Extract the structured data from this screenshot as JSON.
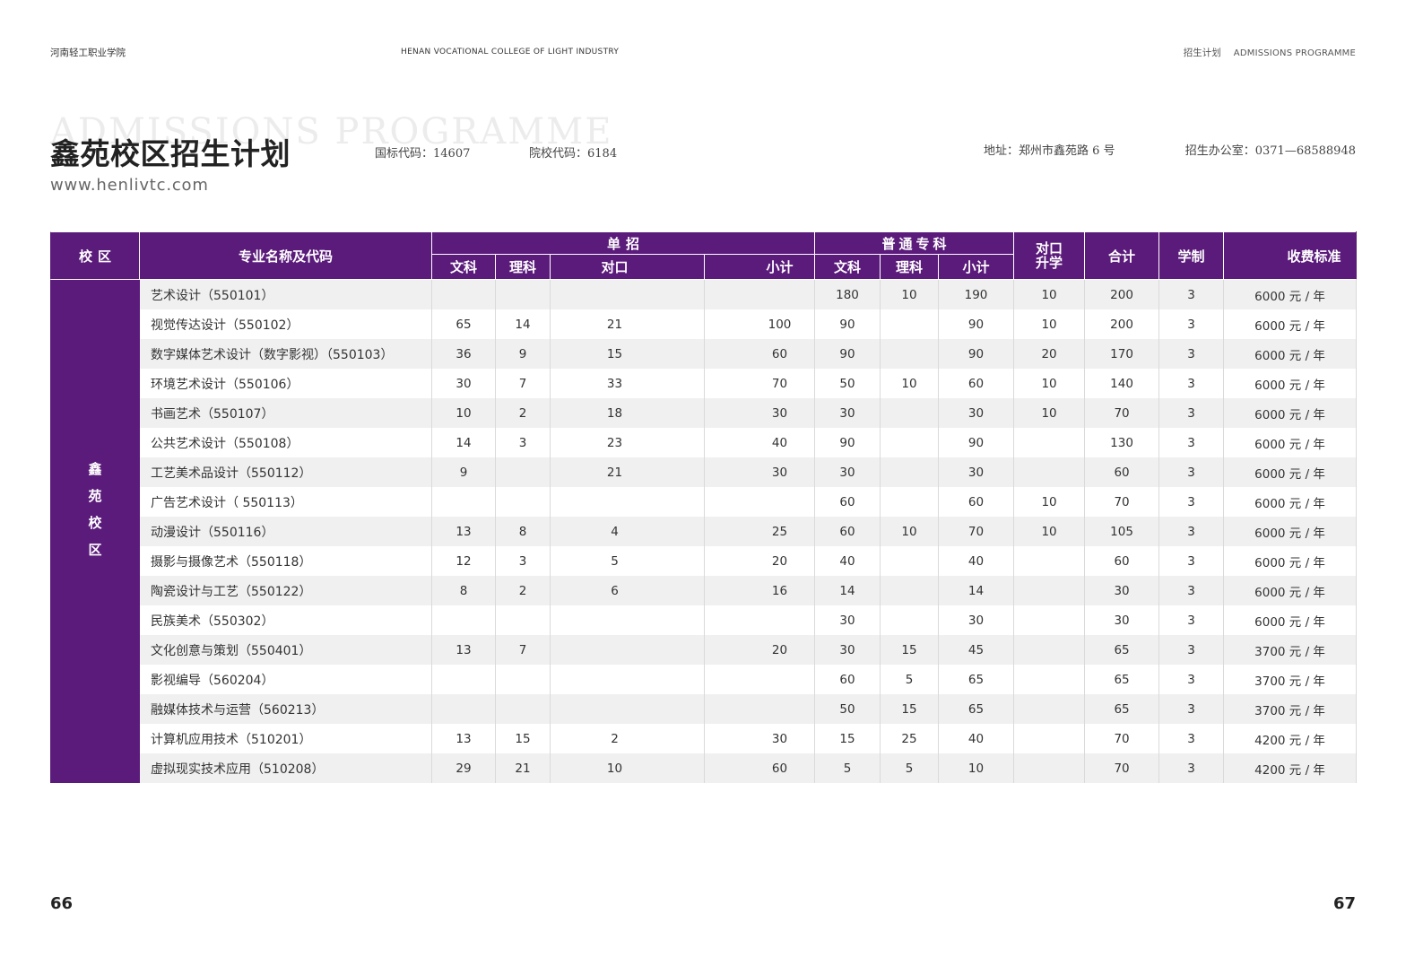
{
  "header": {
    "college_cn": "河南轻工职业学院",
    "college_en": "HENAN VOCATIONAL COLLEGE OF LIGHT INDUSTRY",
    "section_cn": "招生计划",
    "section_en": "ADMISSIONS PROGRAMME"
  },
  "title": {
    "watermark": "ADMISSIONS PROGRAMME",
    "main": "鑫苑校区招生计划",
    "national_code": "国标代码：14607",
    "school_code": "院校代码：6184",
    "address": "地址：郑州市鑫苑路 6 号",
    "office": "招生办公室：0371—68588948",
    "website": "www.henlivtc.com"
  },
  "table": {
    "headers": {
      "campus": "校区",
      "major": "专业名称及代码",
      "single_group": "单招",
      "single_sub": [
        "文科",
        "理科",
        "对口",
        "小计"
      ],
      "general_group": "普通专科",
      "general_sub": [
        "文科",
        "理科",
        "小计"
      ],
      "counterpart": [
        "对口",
        "升学"
      ],
      "total": "合计",
      "duration": "学制",
      "fee": "收费标准"
    },
    "campus_chars": [
      "鑫",
      "苑",
      "校",
      "区"
    ],
    "rows": [
      {
        "major": "艺术设计（550101）",
        "single": [
          "",
          "",
          "",
          ""
        ],
        "general": [
          180,
          10,
          190
        ],
        "counterpart": 10,
        "total": 200,
        "duration": 3,
        "fee": "6000 元 / 年"
      },
      {
        "major": "视觉传达设计（550102）",
        "single": [
          65,
          14,
          21,
          100
        ],
        "general": [
          90,
          "",
          90
        ],
        "counterpart": 10,
        "total": 200,
        "duration": 3,
        "fee": "6000 元 / 年"
      },
      {
        "major": "数字媒体艺术设计（数字影视）（550103）",
        "single": [
          36,
          9,
          15,
          60
        ],
        "general": [
          90,
          "",
          90
        ],
        "counterpart": 20,
        "total": 170,
        "duration": 3,
        "fee": "6000 元 / 年"
      },
      {
        "major": "环境艺术设计（550106）",
        "single": [
          30,
          7,
          33,
          70
        ],
        "general": [
          50,
          10,
          60
        ],
        "counterpart": 10,
        "total": 140,
        "duration": 3,
        "fee": "6000 元 / 年"
      },
      {
        "major": "书画艺术（550107）",
        "single": [
          10,
          2,
          18,
          30
        ],
        "general": [
          30,
          "",
          30
        ],
        "counterpart": 10,
        "total": 70,
        "duration": 3,
        "fee": "6000 元 / 年"
      },
      {
        "major": "公共艺术设计（550108）",
        "single": [
          14,
          3,
          23,
          40
        ],
        "general": [
          90,
          "",
          90
        ],
        "counterpart": "",
        "total": 130,
        "duration": 3,
        "fee": "6000 元 / 年"
      },
      {
        "major": "工艺美术品设计（550112）",
        "single": [
          9,
          "",
          21,
          30
        ],
        "general": [
          30,
          "",
          30
        ],
        "counterpart": "",
        "total": 60,
        "duration": 3,
        "fee": "6000 元 / 年"
      },
      {
        "major": "广告艺术设计（ 550113）",
        "single": [
          "",
          "",
          "",
          ""
        ],
        "general": [
          60,
          "",
          60
        ],
        "counterpart": 10,
        "total": 70,
        "duration": 3,
        "fee": "6000 元 / 年"
      },
      {
        "major": "动漫设计（550116）",
        "single": [
          13,
          8,
          4,
          25
        ],
        "general": [
          60,
          10,
          70
        ],
        "counterpart": 10,
        "total": 105,
        "duration": 3,
        "fee": "6000 元 / 年"
      },
      {
        "major": "摄影与摄像艺术（550118）",
        "single": [
          12,
          3,
          5,
          20
        ],
        "general": [
          40,
          "",
          40
        ],
        "counterpart": "",
        "total": 60,
        "duration": 3,
        "fee": "6000 元 / 年"
      },
      {
        "major": "陶瓷设计与工艺（550122）",
        "single": [
          8,
          2,
          6,
          16
        ],
        "general": [
          14,
          "",
          14
        ],
        "counterpart": "",
        "total": 30,
        "duration": 3,
        "fee": "6000 元 / 年"
      },
      {
        "major": "民族美术（550302）",
        "single": [
          "",
          "",
          "",
          ""
        ],
        "general": [
          30,
          "",
          30
        ],
        "counterpart": "",
        "total": 30,
        "duration": 3,
        "fee": "6000 元 / 年"
      },
      {
        "major": "文化创意与策划（550401）",
        "single": [
          13,
          7,
          "",
          20
        ],
        "general": [
          30,
          15,
          45
        ],
        "counterpart": "",
        "total": 65,
        "duration": 3,
        "fee": "3700 元 / 年"
      },
      {
        "major": "影视编导（560204）",
        "single": [
          "",
          "",
          "",
          ""
        ],
        "general": [
          60,
          5,
          65
        ],
        "counterpart": "",
        "total": 65,
        "duration": 3,
        "fee": "3700 元 / 年"
      },
      {
        "major": "融媒体技术与运营（560213）",
        "single": [
          "",
          "",
          "",
          ""
        ],
        "general": [
          50,
          15,
          65
        ],
        "counterpart": "",
        "total": 65,
        "duration": 3,
        "fee": "3700 元 / 年"
      },
      {
        "major": "计算机应用技术（510201）",
        "single": [
          13,
          15,
          2,
          30
        ],
        "general": [
          15,
          25,
          40
        ],
        "counterpart": "",
        "total": 70,
        "duration": 3,
        "fee": "4200 元 / 年"
      },
      {
        "major": "虚拟现实技术应用（510208）",
        "single": [
          29,
          21,
          10,
          60
        ],
        "general": [
          5,
          5,
          10
        ],
        "counterpart": "",
        "total": 70,
        "duration": 3,
        "fee": "4200 元 / 年"
      }
    ]
  },
  "footer": {
    "page_left": "66",
    "page_right": "67"
  },
  "colors": {
    "accent": "#5b1b7b",
    "row_alt": "#f0f0f0"
  }
}
